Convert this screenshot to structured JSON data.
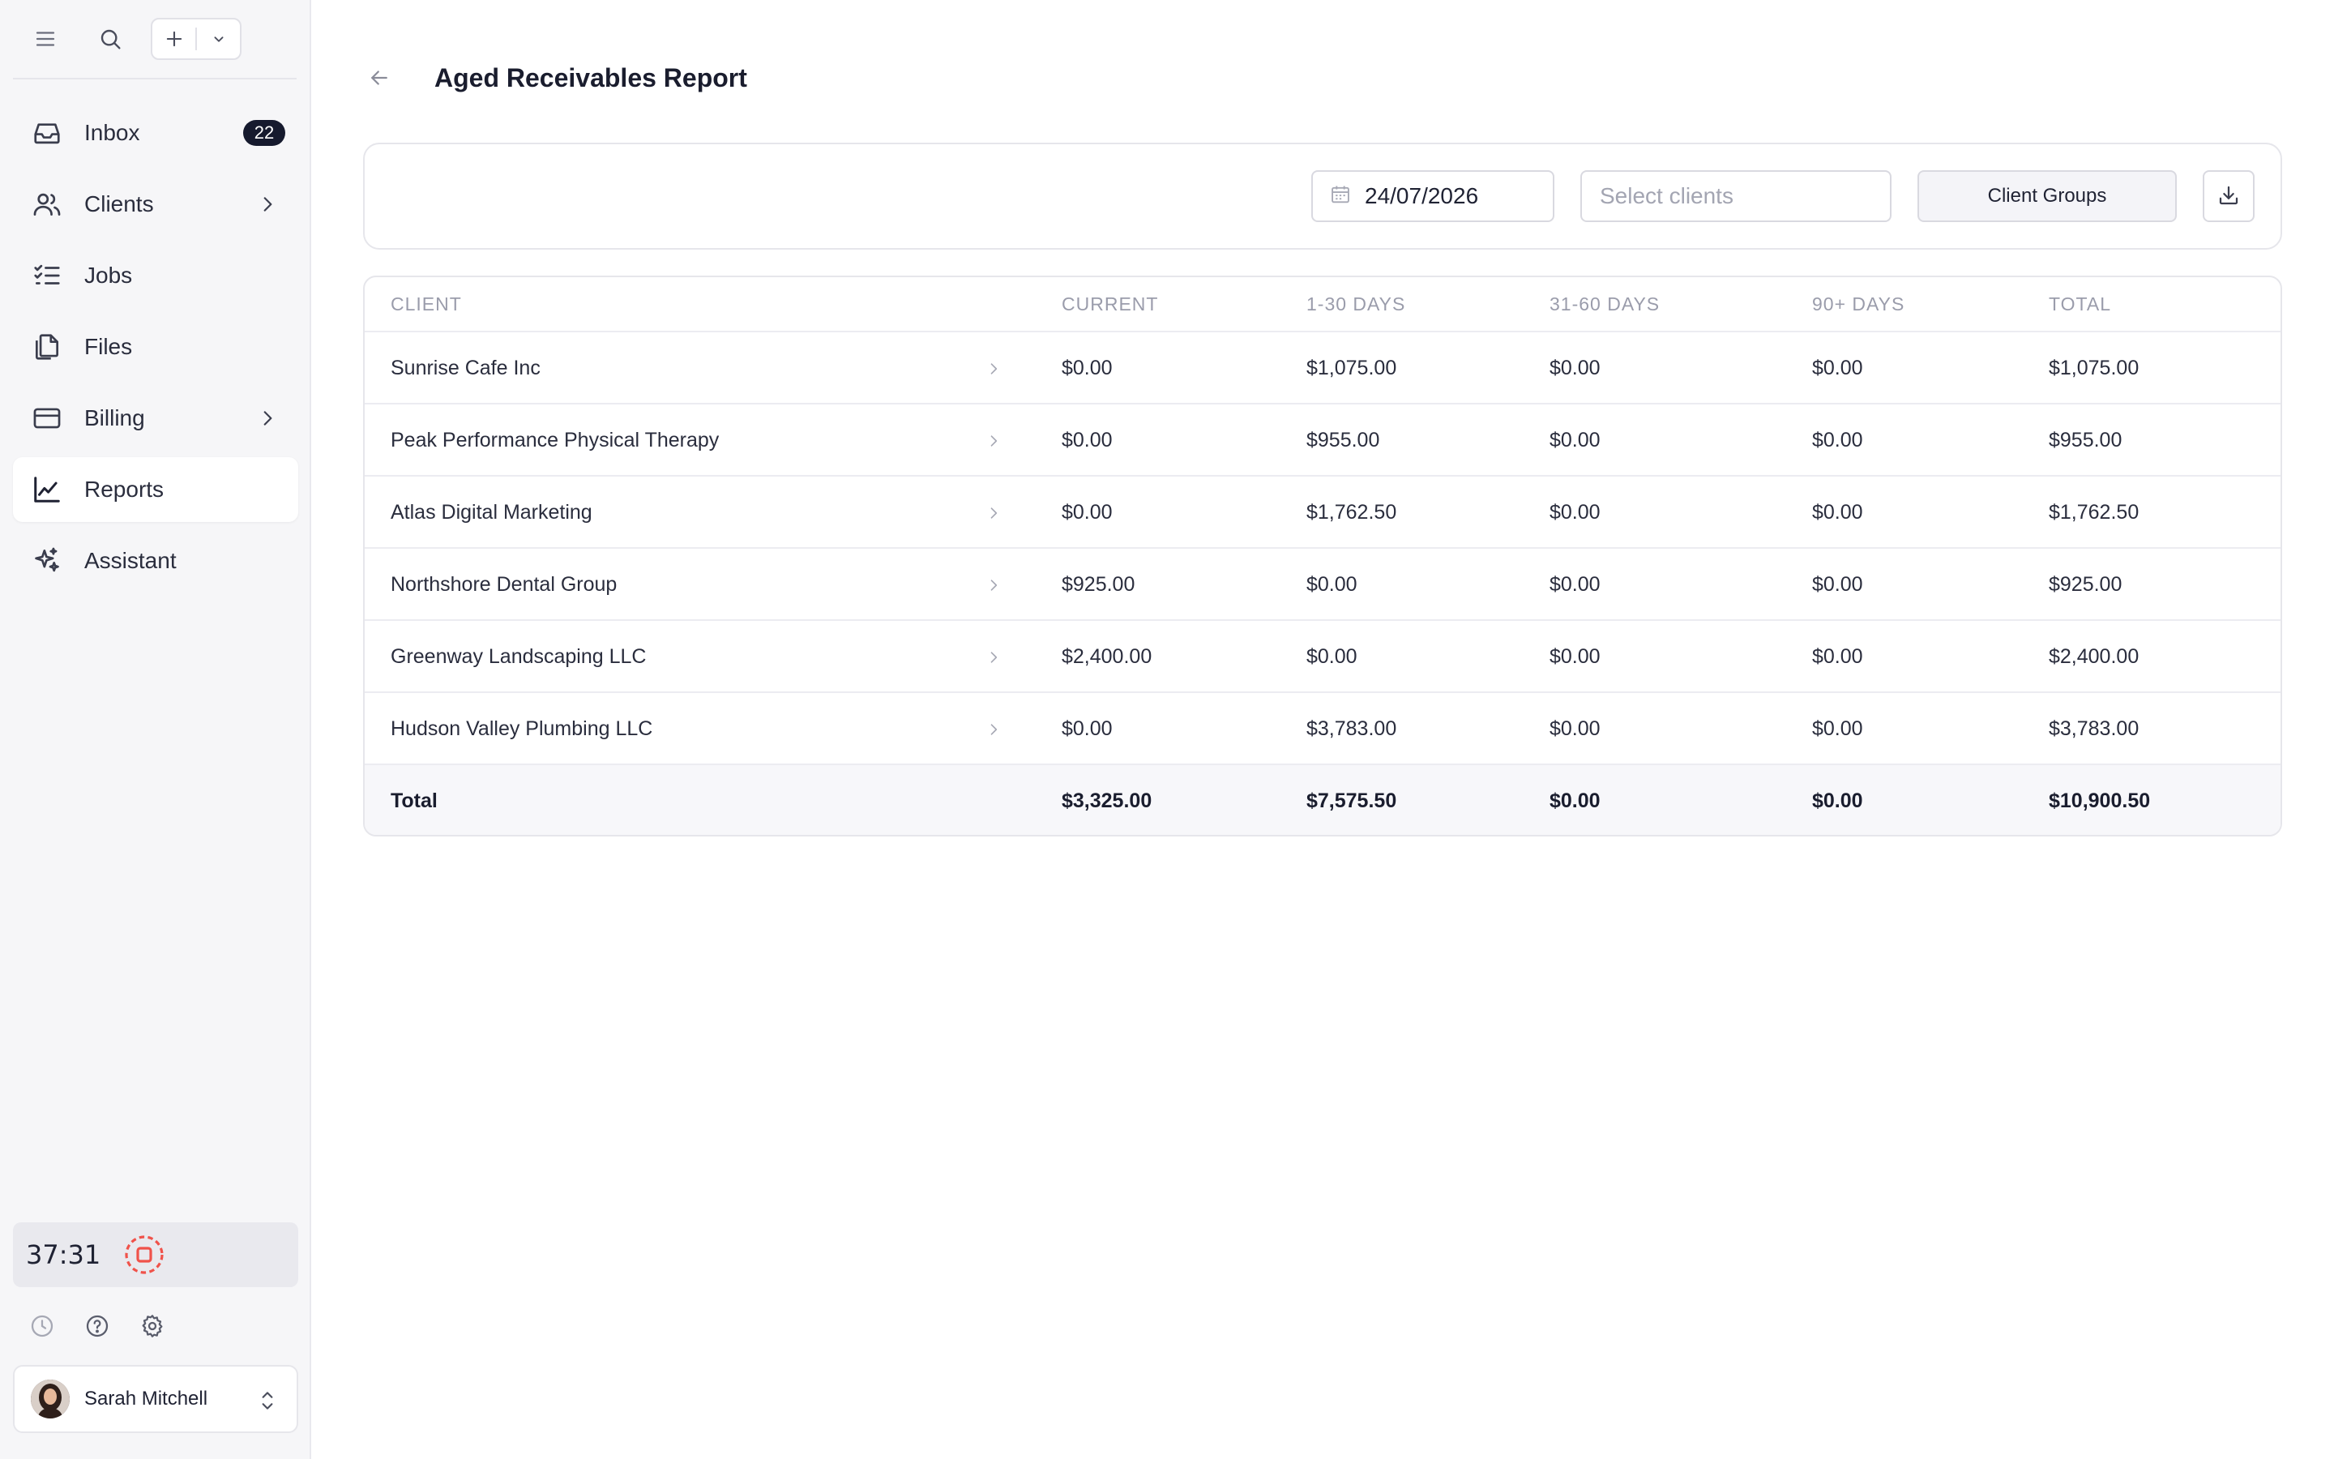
{
  "sidebar": {
    "top_icons": [
      "menu-icon",
      "search-icon",
      "plus-icon",
      "chevron-down-icon"
    ],
    "items": [
      {
        "label": "Inbox",
        "icon": "inbox-icon",
        "badge": "22"
      },
      {
        "label": "Clients",
        "icon": "users-icon",
        "has_chevron": true
      },
      {
        "label": "Jobs",
        "icon": "checklist-icon"
      },
      {
        "label": "Files",
        "icon": "files-icon"
      },
      {
        "label": "Billing",
        "icon": "credit-card-icon",
        "has_chevron": true
      },
      {
        "label": "Reports",
        "icon": "line-chart-icon",
        "active": true
      },
      {
        "label": "Assistant",
        "icon": "sparkles-icon"
      }
    ],
    "timer": {
      "time": "37:31"
    },
    "user": {
      "name": "Sarah Mitchell"
    }
  },
  "header": {
    "title": "Aged Receivables Report"
  },
  "filters": {
    "date": "24/07/2026",
    "clients_placeholder": "Select clients",
    "groups_label": "Client Groups"
  },
  "table": {
    "columns": [
      "CLIENT",
      "CURRENT",
      "1-30 DAYS",
      "31-60 DAYS",
      "90+ DAYS",
      "TOTAL"
    ],
    "rows": [
      {
        "client": "Sunrise Cafe Inc",
        "current": "$0.00",
        "d1_30": "$1,075.00",
        "d31_60": "$0.00",
        "d90": "$0.00",
        "total": "$1,075.00"
      },
      {
        "client": "Peak Performance Physical Therapy",
        "current": "$0.00",
        "d1_30": "$955.00",
        "d31_60": "$0.00",
        "d90": "$0.00",
        "total": "$955.00"
      },
      {
        "client": "Atlas Digital Marketing",
        "current": "$0.00",
        "d1_30": "$1,762.50",
        "d31_60": "$0.00",
        "d90": "$0.00",
        "total": "$1,762.50"
      },
      {
        "client": "Northshore Dental Group",
        "current": "$925.00",
        "d1_30": "$0.00",
        "d31_60": "$0.00",
        "d90": "$0.00",
        "total": "$925.00"
      },
      {
        "client": "Greenway Landscaping LLC",
        "current": "$2,400.00",
        "d1_30": "$0.00",
        "d31_60": "$0.00",
        "d90": "$0.00",
        "total": "$2,400.00"
      },
      {
        "client": "Hudson Valley Plumbing LLC",
        "current": "$0.00",
        "d1_30": "$3,783.00",
        "d31_60": "$0.00",
        "d90": "$0.00",
        "total": "$3,783.00"
      }
    ],
    "totals": {
      "label": "Total",
      "current": "$3,325.00",
      "d1_30": "$7,575.50",
      "d31_60": "$0.00",
      "d90": "$0.00",
      "total": "$10,900.50"
    }
  },
  "colors": {
    "accent_dark": "#161a2e",
    "timer_stop": "#f0524a",
    "sidebar_bg": "#f6f6f8"
  }
}
